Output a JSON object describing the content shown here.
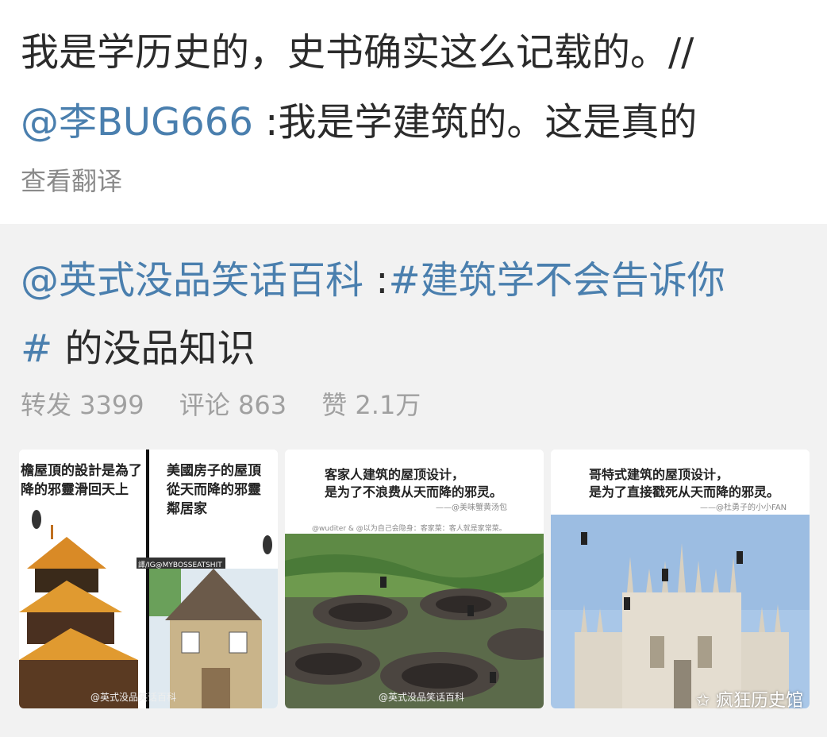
{
  "post": {
    "line1": "我是学历史的，史书确实这么记载的。//",
    "mention": "@李BUG666",
    "line2_rest": " :我是学建筑的。这是真的",
    "translate": "查看翻译"
  },
  "repost": {
    "author": "@英式没品笑话百科",
    "colon": " :",
    "hashtag_start": "#建筑学不会告诉你",
    "hashtag_end": "#",
    "rest": " 的没品知识",
    "stats": {
      "reposts": "转发 3399",
      "comments": "评论 863",
      "likes": "赞 2.1万"
    }
  },
  "images": [
    {
      "left_caption_1": "檐屋頂的設計是為了",
      "left_caption_2": "降的邪靈滑回天上",
      "right_caption_1": "美國房子的屋頂",
      "right_caption_2": "從天而降的邪靈",
      "right_caption_3": "鄰居家",
      "credit": "譯/IG@MYBOSSEATSHIT",
      "watermark": "@英式没品笑话百科"
    },
    {
      "caption_1": "客家人建筑的屋顶设计，",
      "caption_2": "是为了不浪费从天而降的邪灵。",
      "credit": "——@美味蟹黄汤包",
      "sub": "@wuditer & @以为自己会隐身：客家菜：客人就是家常菜。",
      "watermark": "@英式没品笑话百科"
    },
    {
      "caption_1": "哥特式建筑的屋顶设计，",
      "caption_2": "是为了直接戳死从天而降的邪灵。",
      "credit": "——@杜勇子的小小FAN"
    }
  ],
  "footer_watermark": "疯狂历史馆",
  "colors": {
    "link": "#4a7fae",
    "muted": "#8a8a8a",
    "repost_bg": "#f2f2f2"
  }
}
